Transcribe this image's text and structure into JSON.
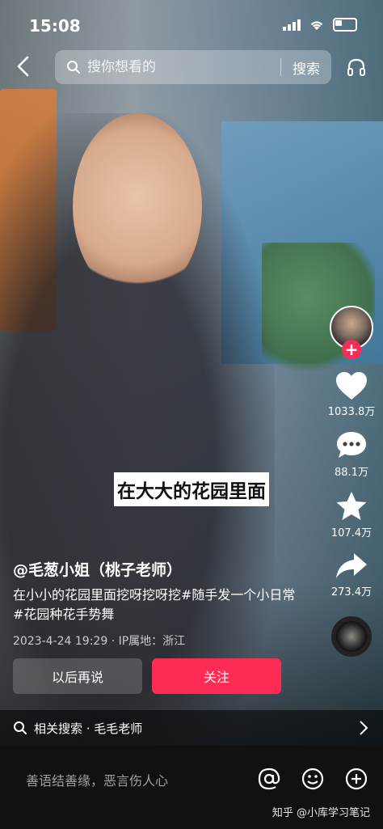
{
  "status_bar": {
    "time": "15:08"
  },
  "top_bar": {
    "search_placeholder": "搜你想看的",
    "search_button": "搜索"
  },
  "subtitle": "在大大的花园里面",
  "rail": {
    "likes": "1033.8万",
    "comments": "88.1万",
    "favorites": "107.4万",
    "shares": "273.4万"
  },
  "post": {
    "author": "@毛葱小姐（桃子老师）",
    "description": "在小小的花园里面挖呀挖呀挖#随手发一个小日常 #花园种花手势舞",
    "meta": "2023-4-24 19:29 · IP属地：浙江"
  },
  "buttons": {
    "later": "以后再说",
    "follow": "关注"
  },
  "related_search": "相关搜索 · 毛毛老师",
  "bottom_bar": {
    "comment_placeholder": "善语结善缘，恶言伤人心",
    "watermark": "知乎 @小库学习笔记"
  },
  "colors": {
    "accent": "#fe2c55"
  },
  "icons": [
    "back-arrow-icon",
    "search-icon",
    "headphone-icon",
    "heart-icon",
    "comment-icon",
    "star-icon",
    "share-icon",
    "at-icon",
    "emoji-icon",
    "plus-icon",
    "chevron-right-icon"
  ]
}
